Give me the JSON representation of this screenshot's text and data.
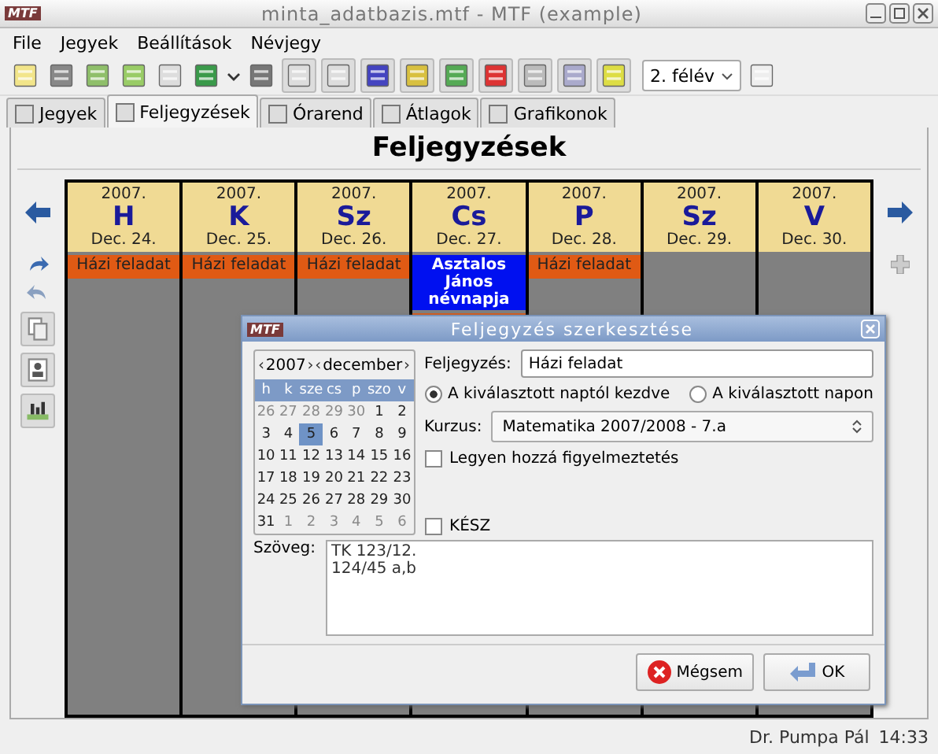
{
  "window": {
    "title": "minta_adatbazis.mtf - MTF (example)",
    "logo": "MTF"
  },
  "menu": [
    "File",
    "Jegyek",
    "Beállítások",
    "Névjegy"
  ],
  "toolbar": {
    "semester": "2. félév"
  },
  "tabs": [
    {
      "label": "Jegyek",
      "selected": false
    },
    {
      "label": "Feljegyzések",
      "selected": true
    },
    {
      "label": "Órarend",
      "selected": false
    },
    {
      "label": "Átlagok",
      "selected": false
    },
    {
      "label": "Grafikonok",
      "selected": false
    }
  ],
  "heading": "Feljegyzések",
  "days": [
    {
      "year": "2007.",
      "day": "H",
      "date": "Dec. 24.",
      "events": [
        {
          "kind": "homework",
          "label": "Házi feladat"
        }
      ]
    },
    {
      "year": "2007.",
      "day": "K",
      "date": "Dec. 25.",
      "events": [
        {
          "kind": "homework",
          "label": "Házi feladat"
        }
      ]
    },
    {
      "year": "2007.",
      "day": "Sz",
      "date": "Dec. 26.",
      "events": [
        {
          "kind": "homework",
          "label": "Házi feladat"
        }
      ]
    },
    {
      "year": "2007.",
      "day": "Cs",
      "date": "Dec. 27.",
      "events": [
        {
          "kind": "nameday",
          "label": "Asztalos János névnapja"
        },
        {
          "kind": "homework"
        }
      ]
    },
    {
      "year": "2007.",
      "day": "P",
      "date": "Dec. 28.",
      "events": [
        {
          "kind": "homework",
          "label": "Házi feladat"
        }
      ]
    },
    {
      "year": "2007.",
      "day": "Sz",
      "date": "Dec. 29."
    },
    {
      "year": "2007.",
      "day": "V",
      "date": "Dec. 30."
    }
  ],
  "dialog": {
    "title": "Feljegyzés szerkesztése",
    "logo": "MTF",
    "calendar": {
      "year": "2007",
      "month": "december",
      "prev": "‹",
      "next": "›",
      "weekdays": [
        "h",
        "k",
        "sze",
        "cs",
        "p",
        "szo",
        "v"
      ],
      "weeks": [
        [
          {
            "d": "26",
            "other": true
          },
          {
            "d": "27",
            "other": true
          },
          {
            "d": "28",
            "other": true
          },
          {
            "d": "29",
            "other": true
          },
          {
            "d": "30",
            "other": true
          },
          {
            "d": "1",
            "other": false
          },
          {
            "d": "2",
            "other": false
          }
        ],
        [
          {
            "d": "3",
            "other": false
          },
          {
            "d": "4",
            "other": false
          },
          {
            "d": "5",
            "other": false,
            "selected": true
          },
          {
            "d": "6",
            "other": false
          },
          {
            "d": "7",
            "other": false
          },
          {
            "d": "8",
            "other": false
          },
          {
            "d": "9",
            "other": false
          }
        ],
        [
          {
            "d": "10",
            "other": false
          },
          {
            "d": "11",
            "other": false
          },
          {
            "d": "12",
            "other": false
          },
          {
            "d": "13",
            "other": false
          },
          {
            "d": "14",
            "other": false
          },
          {
            "d": "15",
            "other": false
          },
          {
            "d": "16",
            "other": false
          }
        ],
        [
          {
            "d": "17",
            "other": false
          },
          {
            "d": "18",
            "other": false
          },
          {
            "d": "19",
            "other": false
          },
          {
            "d": "20",
            "other": false
          },
          {
            "d": "21",
            "other": false
          },
          {
            "d": "22",
            "other": false
          },
          {
            "d": "23",
            "other": false
          }
        ],
        [
          {
            "d": "24",
            "other": false
          },
          {
            "d": "25",
            "other": false
          },
          {
            "d": "26",
            "other": false
          },
          {
            "d": "27",
            "other": false
          },
          {
            "d": "28",
            "other": false
          },
          {
            "d": "29",
            "other": false
          },
          {
            "d": "30",
            "other": false
          }
        ],
        [
          {
            "d": "31",
            "other": false
          },
          {
            "d": "1",
            "other": true
          },
          {
            "d": "2",
            "other": true
          },
          {
            "d": "3",
            "other": true
          },
          {
            "d": "4",
            "other": true
          },
          {
            "d": "5",
            "other": true
          },
          {
            "d": "6",
            "other": true
          }
        ]
      ]
    },
    "note_label": "Feljegyzés:",
    "note_value": "Házi feladat",
    "radios": [
      {
        "label": "A kiválasztott naptól kezdve",
        "selected": true
      },
      {
        "label": "A kiválasztott napon",
        "selected": false
      }
    ],
    "course_label": "Kurzus:",
    "course_value": "Matematika 2007/2008 - 7.a",
    "checkboxes": [
      {
        "label": "Legyen hozzá figyelmeztetés",
        "checked": false
      },
      {
        "label": "KÉSZ",
        "checked": false
      }
    ],
    "text_label": "Szöveg:",
    "text_value": "TK 123/12.\n124/45 a,b",
    "buttons": [
      {
        "kind": "cancel",
        "label": "Mégsem"
      },
      {
        "kind": "ok",
        "label": "OK"
      }
    ]
  },
  "status_bar": {
    "user": "Dr. Pumpa Pál",
    "time": "14:33"
  }
}
